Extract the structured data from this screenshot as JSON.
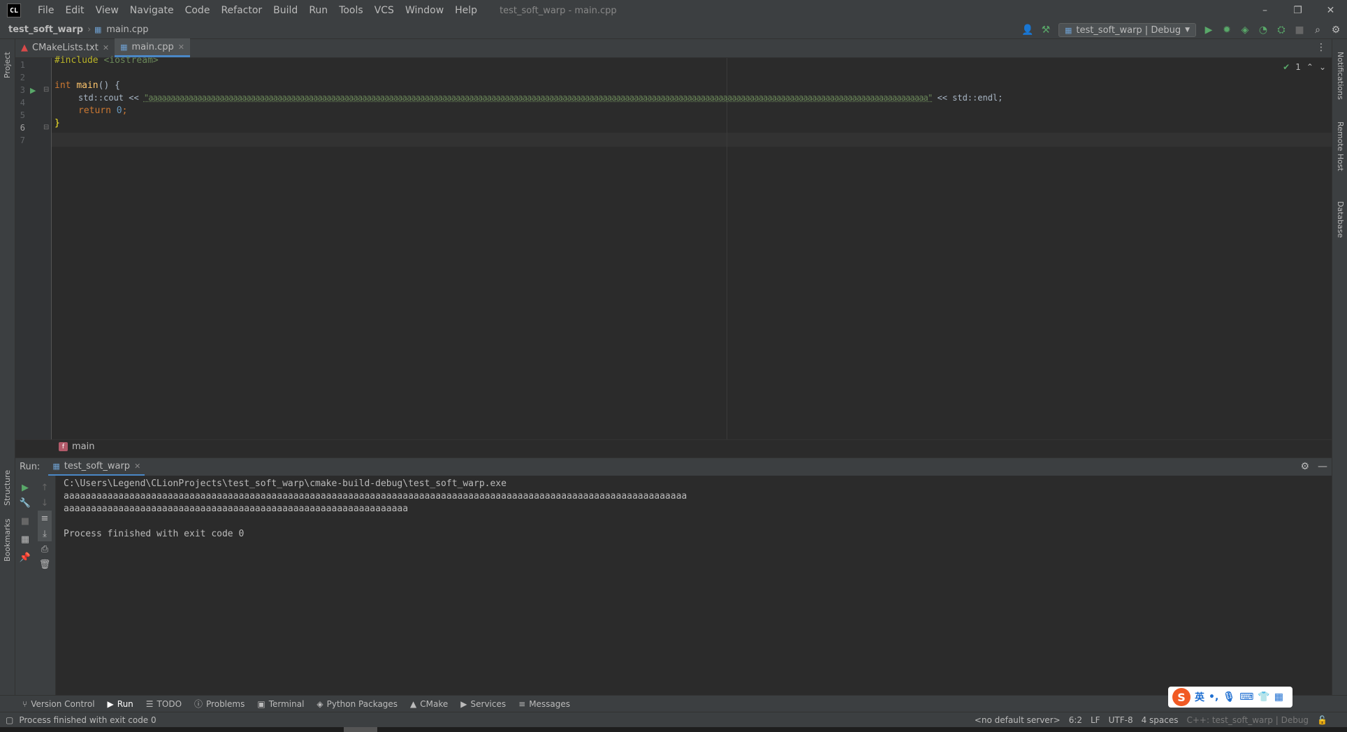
{
  "titlebar": {
    "logo": "CL",
    "menu": [
      "File",
      "Edit",
      "View",
      "Navigate",
      "Code",
      "Refactor",
      "Build",
      "Run",
      "Tools",
      "VCS",
      "Window",
      "Help"
    ],
    "window_title": "test_soft_warp - main.cpp",
    "controls": [
      "–",
      "❐",
      "✕"
    ]
  },
  "navbar": {
    "project": "test_soft_warp",
    "file": "main.cpp",
    "run_config": "test_soft_warp | Debug"
  },
  "tabs": [
    {
      "label": "CMakeLists.txt",
      "active": false
    },
    {
      "label": "main.cpp",
      "active": true
    }
  ],
  "editor": {
    "line_numbers": [
      "1",
      "2",
      "3",
      "4",
      "5",
      "6",
      "7"
    ],
    "inspection_count": "1",
    "code": {
      "l1_directive": "#include",
      "l1_header": "<iostream>",
      "l3_type": "int",
      "l3_name": "main",
      "l3_rest": "() {",
      "l4_prefix": "std::cout << ",
      "l4_string": "\"aaaaaaaaaaaaaaaaaaaaaaaaaaaaaaaaaaaaaaaaaaaaaaaaaaaaaaaaaaaaaaaaaaaaaaaaaaaaaaaaaaaaaaaaaaaaaaaaaaaaaaaaaaaaaaaaaaaaaaaaaaaaaaaaaaaaaaaaaaaaaaaaaaaaaaaaaaaaaaaaaaaaaaaaaaaaaaa\"",
      "l4_suffix": " << std::endl;",
      "l5_keyword": "return",
      "l5_num": "0",
      "l5_end": ";",
      "l6": "}"
    }
  },
  "breadcrumb": {
    "badge": "f",
    "label": "main"
  },
  "run_panel": {
    "label": "Run:",
    "tab": "test_soft_warp",
    "console": [
      "C:\\Users\\Legend\\CLionProjects\\test_soft_warp\\cmake-build-debug\\test_soft_warp.exe",
      "aaaaaaaaaaaaaaaaaaaaaaaaaaaaaaaaaaaaaaaaaaaaaaaaaaaaaaaaaaaaaaaaaaaaaaaaaaaaaaaaaaaaaaaaaaaaaaaaaaaaaaaaaaaaaaaaaa",
      "aaaaaaaaaaaaaaaaaaaaaaaaaaaaaaaaaaaaaaaaaaaaaaaaaaaaaaaaaaaaaaa",
      "",
      "Process finished with exit code 0"
    ]
  },
  "side_labels": {
    "left_top": "Project",
    "left_mid": "Structure",
    "left_bottom": "Bookmarks",
    "right_1": "Notifications",
    "right_2": "Remote Host",
    "right_3": "Database"
  },
  "bottom_tabs": [
    "Version Control",
    "Run",
    "TODO",
    "Problems",
    "Terminal",
    "Python Packages",
    "CMake",
    "Services",
    "Messages"
  ],
  "statusbar": {
    "message": "Process finished with exit code 0",
    "server": "<no default server>",
    "position": "6:2",
    "line_sep": "LF",
    "encoding": "UTF-8",
    "indent": "4 spaces",
    "context": "C++: test_soft_warp | Debug"
  },
  "ime": {
    "logo": "S",
    "lang": "英"
  }
}
